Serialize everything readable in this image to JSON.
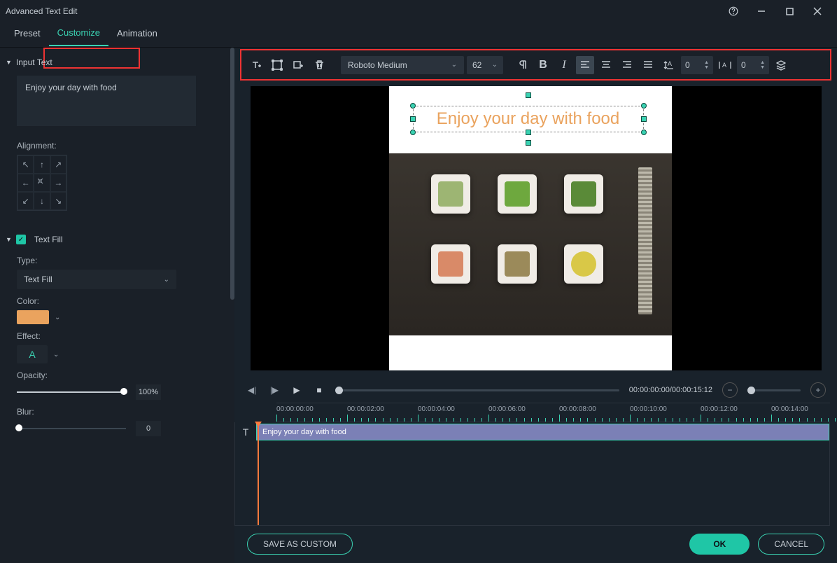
{
  "title": "Advanced Text Edit",
  "tabs": {
    "preset": "Preset",
    "customize": "Customize",
    "animation": "Animation"
  },
  "sidebar": {
    "input_text_hdr": "Input Text",
    "text_value": "Enjoy your day with food",
    "alignment_label": "Alignment:",
    "text_fill_hdr": "Text Fill",
    "type_label": "Type:",
    "type_value": "Text Fill",
    "color_label": "Color:",
    "effect_label": "Effect:",
    "effect_value": "A",
    "opacity_label": "Opacity:",
    "opacity_value": "100%",
    "blur_label": "Blur:",
    "blur_value": "0",
    "fill_color": "#eaa35e"
  },
  "toolbar": {
    "font": "Roboto Medium",
    "size": "62",
    "line_spacing": "0",
    "char_spacing": "0"
  },
  "preview": {
    "overlay_text": "Enjoy your day with food"
  },
  "playback": {
    "timecode": "00:00:00:00/00:00:15:12"
  },
  "timeline": {
    "ticks": [
      "00:00:00:00",
      "00:00:02:00",
      "00:00:04:00",
      "00:00:06:00",
      "00:00:08:00",
      "00:00:10:00",
      "00:00:12:00",
      "00:00:14:00"
    ],
    "clip_label": "Enjoy your day with food"
  },
  "footer": {
    "save": "SAVE AS CUSTOM",
    "ok": "OK",
    "cancel": "CANCEL"
  }
}
